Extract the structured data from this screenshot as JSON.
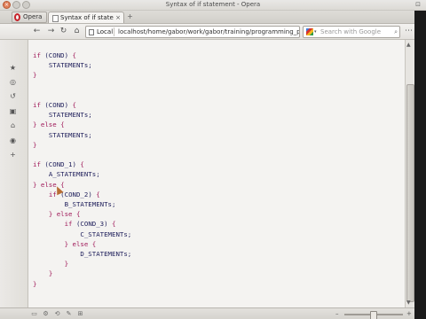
{
  "window": {
    "title": "Syntax of if statement - Opera",
    "close_glyph": "×",
    "min_glyph": "–",
    "max_glyph": "□",
    "corner_glyph": "⊡"
  },
  "tabbar": {
    "opera_label": "Opera",
    "tab_title": "Syntax of if stateme...",
    "tab_close": "×",
    "new_tab": "+",
    "right_glyph": "⊡"
  },
  "navbar": {
    "back": "←",
    "forward": "→",
    "reload": "↻",
    "home": "⌂",
    "url_scheme": "Local",
    "url": "localhost/home/gabor/work/gabor/training/programming_pe",
    "search_placeholder": "Search with Google",
    "search_go": "⌕",
    "search_caret": "▾",
    "menu": "⋯"
  },
  "sidepanel": {
    "icons": [
      "★",
      "◎",
      "↺",
      "▣",
      "⌂",
      "◉",
      "+"
    ]
  },
  "code": {
    "lines": [
      {
        "kw": "if",
        "tx": " (COND) ",
        "br": "{",
        "indent": ""
      },
      {
        "tx": "STATEMENTs;",
        "indent": "    "
      },
      {
        "br": "}",
        "indent": ""
      },
      {
        "indent": ""
      },
      {
        "indent": ""
      },
      {
        "kw": "if",
        "tx": " (COND) ",
        "br": "{",
        "indent": ""
      },
      {
        "tx": "STATEMENTs;",
        "indent": "    "
      },
      {
        "br": "} else {",
        "indent": ""
      },
      {
        "tx": "STATEMENTs;",
        "indent": "    "
      },
      {
        "br": "}",
        "indent": ""
      },
      {
        "indent": ""
      },
      {
        "kw": "if",
        "tx": " (COND_1) ",
        "br": "{",
        "indent": ""
      },
      {
        "tx": "A_STATEMENTs;",
        "indent": "    "
      },
      {
        "br": "} else {",
        "indent": ""
      },
      {
        "kw": "if",
        "tx": " (COND_2) ",
        "br": "{",
        "indent": "    "
      },
      {
        "tx": "B_STATEMENTs;",
        "indent": "        "
      },
      {
        "br": "} else {",
        "indent": "    "
      },
      {
        "kw": "if",
        "tx": " (COND_3) ",
        "br": "{",
        "indent": "        "
      },
      {
        "tx": "C_STATEMENTs;",
        "indent": "            "
      },
      {
        "br": "} else {",
        "indent": "        "
      },
      {
        "tx": "D_STATEMENTs;",
        "indent": "            "
      },
      {
        "br": "}",
        "indent": "        "
      },
      {
        "br": "}",
        "indent": "    "
      },
      {
        "br": "}",
        "indent": ""
      }
    ]
  },
  "scrollbar": {
    "up": "▲",
    "down": "▼"
  },
  "statusbar": {
    "icons": [
      "▭",
      "⚙",
      "⟲",
      "✎",
      "⊞"
    ],
    "zoom_minus": "–",
    "zoom_plus": "+",
    "zoom_level": 0.5
  }
}
